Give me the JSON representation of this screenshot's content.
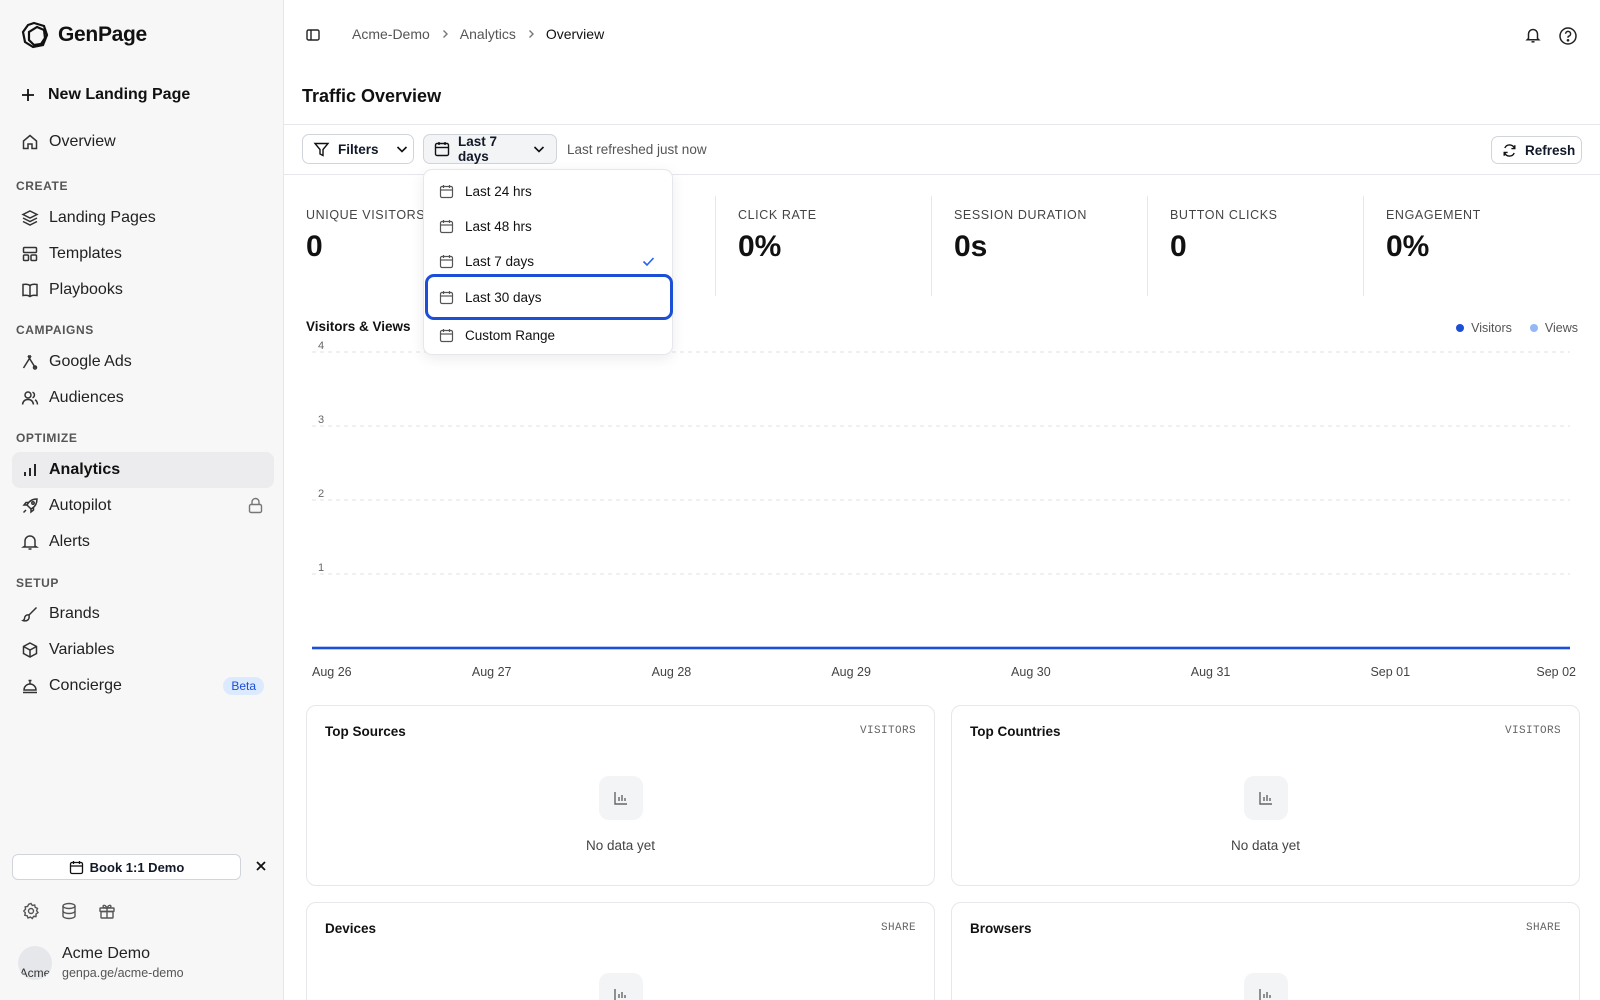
{
  "app": {
    "name": "GenPage"
  },
  "sidebar": {
    "new_page": "New Landing Page",
    "overview": "Overview",
    "sections": {
      "create": "CREATE",
      "campaigns": "CAMPAIGNS",
      "optimize": "OPTIMIZE",
      "setup": "SETUP"
    },
    "items": {
      "landing_pages": "Landing Pages",
      "templates": "Templates",
      "playbooks": "Playbooks",
      "google_ads": "Google Ads",
      "audiences": "Audiences",
      "analytics": "Analytics",
      "autopilot": "Autopilot",
      "alerts": "Alerts",
      "brands": "Brands",
      "variables": "Variables",
      "concierge": "Concierge"
    },
    "beta_badge": "Beta",
    "book_demo": "Book 1:1 Demo",
    "user": {
      "name": "Acme Demo",
      "url": "genpa.ge/acme-demo",
      "avatar_alt": "Acme"
    }
  },
  "breadcrumb": [
    "Acme-Demo",
    "Analytics",
    "Overview"
  ],
  "page": {
    "title": "Traffic Overview"
  },
  "toolbar": {
    "filters": "Filters",
    "date_range": "Last 7 days",
    "refreshed": "Last refreshed just now",
    "refresh": "Refresh"
  },
  "date_options": [
    {
      "label": "Last 24 hrs",
      "selected": false,
      "focused": false
    },
    {
      "label": "Last 48 hrs",
      "selected": false,
      "focused": false
    },
    {
      "label": "Last 7 days",
      "selected": true,
      "focused": false
    },
    {
      "label": "Last 30 days",
      "selected": false,
      "focused": true
    },
    {
      "label": "Custom Range",
      "selected": false,
      "focused": false
    }
  ],
  "stats": [
    {
      "label": "UNIQUE VISITORS",
      "value": "0"
    },
    {
      "label": "",
      "value": ""
    },
    {
      "label": "CLICK RATE",
      "value": "0%"
    },
    {
      "label": "SESSION DURATION",
      "value": "0s"
    },
    {
      "label": "BUTTON CLICKS",
      "value": "0"
    },
    {
      "label": "ENGAGEMENT",
      "value": "0%"
    }
  ],
  "chart_data": {
    "type": "line",
    "title": "Visitors & Views",
    "categories": [
      "Aug 26",
      "Aug 27",
      "Aug 28",
      "Aug 29",
      "Aug 30",
      "Aug 31",
      "Sep 01",
      "Sep 02"
    ],
    "series": [
      {
        "name": "Visitors",
        "color": "#1d4ed8",
        "values": [
          0,
          0,
          0,
          0,
          0,
          0,
          0,
          0
        ]
      },
      {
        "name": "Views",
        "color": "#93b8f5",
        "values": [
          0,
          0,
          0,
          0,
          0,
          0,
          0,
          0
        ]
      }
    ],
    "yticks": [
      1,
      2,
      3,
      4
    ],
    "ylim": [
      0,
      4
    ],
    "grid": true,
    "legend": "top-right"
  },
  "cards": [
    {
      "title": "Top Sources",
      "meta": "VISITORS",
      "empty": "No data yet"
    },
    {
      "title": "Top Countries",
      "meta": "VISITORS",
      "empty": "No data yet"
    },
    {
      "title": "Devices",
      "meta": "SHARE",
      "empty": ""
    },
    {
      "title": "Browsers",
      "meta": "SHARE",
      "empty": ""
    }
  ]
}
